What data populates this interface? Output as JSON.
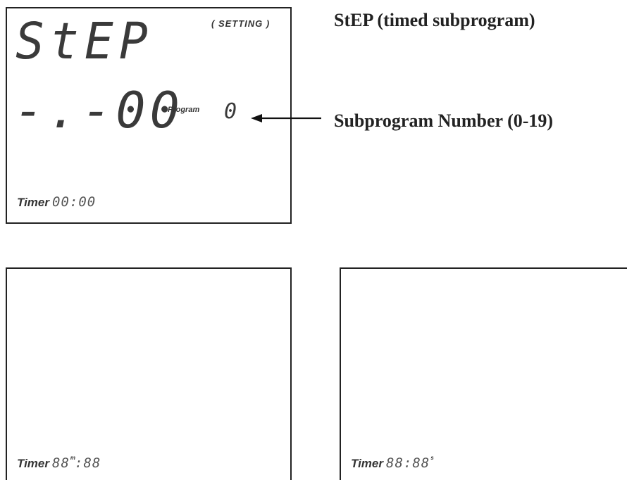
{
  "main_display": {
    "mode_text": "StEP",
    "setting_tag": "( SETTING )",
    "value_text": "-.-00",
    "program_label": "Program",
    "program_number": "0",
    "timer_label": "Timer",
    "timer_value": "00:00"
  },
  "annotations": {
    "title": "StEP (timed subprogram)",
    "subprogram_label": "Subprogram Number (0-19)"
  },
  "bottom_left_display": {
    "timer_label": "Timer",
    "timer_value_min": "88",
    "unit_minutes": "m",
    "timer_value_sec": ":88"
  },
  "bottom_right_display": {
    "timer_label": "Timer",
    "timer_value": "88:88",
    "unit_seconds": "s"
  }
}
